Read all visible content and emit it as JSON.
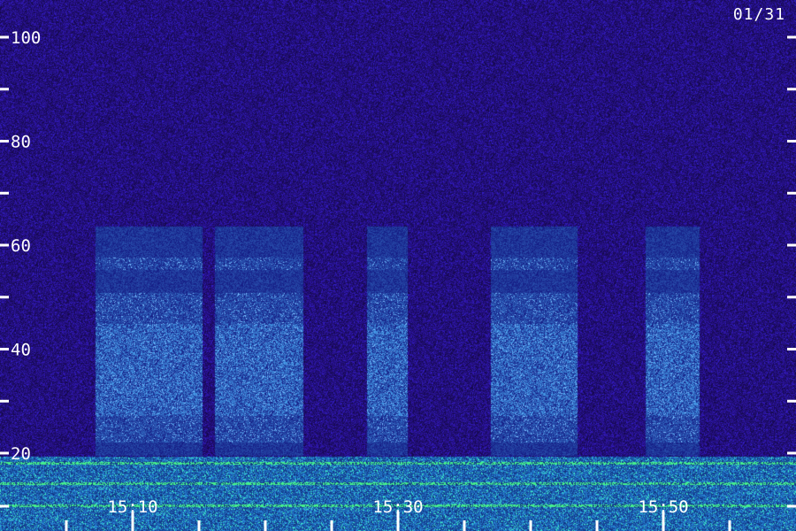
{
  "date_label": "01/31",
  "chart_data": {
    "type": "heatmap",
    "title": "",
    "xlabel": "",
    "ylabel": "",
    "ylim": [
      15,
      105
    ],
    "x_tick_labels": [
      "15:10",
      "15:30",
      "15:50"
    ],
    "y_tick_labels": [
      "20",
      "40",
      "60",
      "80",
      "100"
    ],
    "y_major_ticks": [
      20,
      40,
      60,
      80,
      100
    ],
    "y_minor_ticks": [
      30,
      50,
      70,
      90
    ],
    "grid": false,
    "legend": "none",
    "colors": {
      "background": "#1e0c5c",
      "noise_low": "#2a0aa0",
      "band_signal": "#2e5cf0",
      "band_bright": "#5aa8ff",
      "low_freq_noise": "#3fe0c0",
      "tick": "#ffffff"
    }
  }
}
